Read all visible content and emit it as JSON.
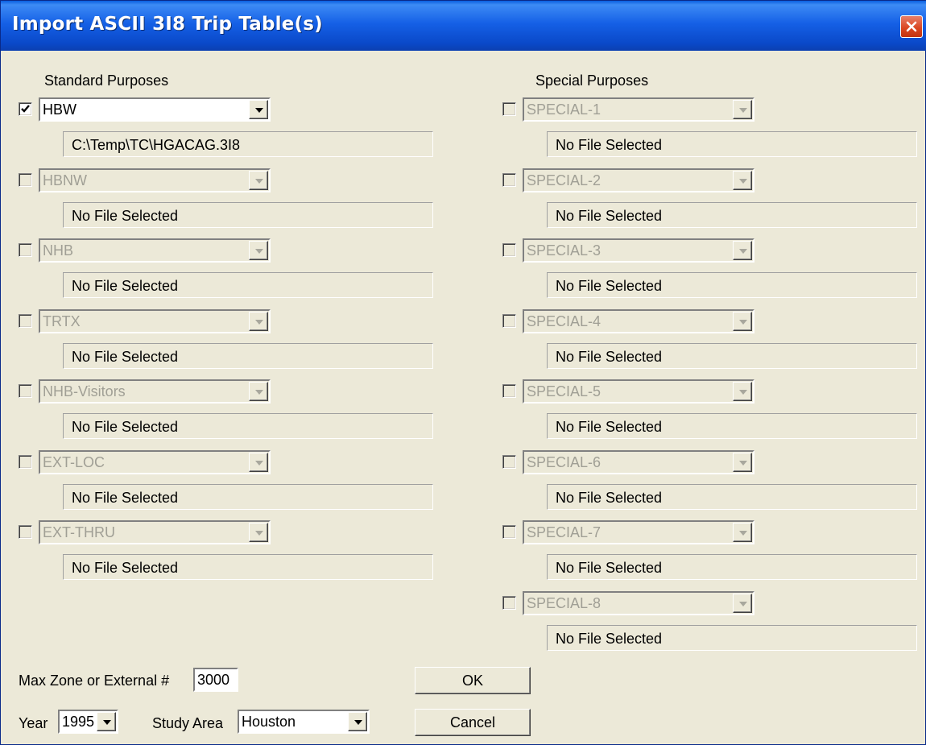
{
  "window": {
    "title": "Import ASCII 3I8 Trip Table(s)"
  },
  "standard": {
    "heading": "Standard Purposes",
    "items": [
      {
        "name": "HBW",
        "file": "C:\\Temp\\TC\\HGACAG.3I8",
        "checked": true
      },
      {
        "name": "HBNW",
        "file": "No File Selected",
        "checked": false
      },
      {
        "name": "NHB",
        "file": "No File Selected",
        "checked": false
      },
      {
        "name": "TRTX",
        "file": "No File Selected",
        "checked": false
      },
      {
        "name": "NHB-Visitors",
        "file": "No File Selected",
        "checked": false
      },
      {
        "name": "EXT-LOC",
        "file": "No File Selected",
        "checked": false
      },
      {
        "name": "EXT-THRU",
        "file": "No File Selected",
        "checked": false
      }
    ]
  },
  "special": {
    "heading": "Special Purposes",
    "items": [
      {
        "name": "SPECIAL-1",
        "file": "No File Selected",
        "checked": false
      },
      {
        "name": "SPECIAL-2",
        "file": "No File Selected",
        "checked": false
      },
      {
        "name": "SPECIAL-3",
        "file": "No File Selected",
        "checked": false
      },
      {
        "name": "SPECIAL-4",
        "file": "No File Selected",
        "checked": false
      },
      {
        "name": "SPECIAL-5",
        "file": "No File Selected",
        "checked": false
      },
      {
        "name": "SPECIAL-6",
        "file": "No File Selected",
        "checked": false
      },
      {
        "name": "SPECIAL-7",
        "file": "No File Selected",
        "checked": false
      },
      {
        "name": "SPECIAL-8",
        "file": "No File Selected",
        "checked": false
      }
    ]
  },
  "bottom": {
    "max_zone_label": "Max Zone or External #",
    "max_zone_value": "3000",
    "year_label": "Year",
    "year_value": "1995",
    "study_area_label": "Study Area",
    "study_area_value": "Houston",
    "ok_label": "OK",
    "cancel_label": "Cancel"
  }
}
